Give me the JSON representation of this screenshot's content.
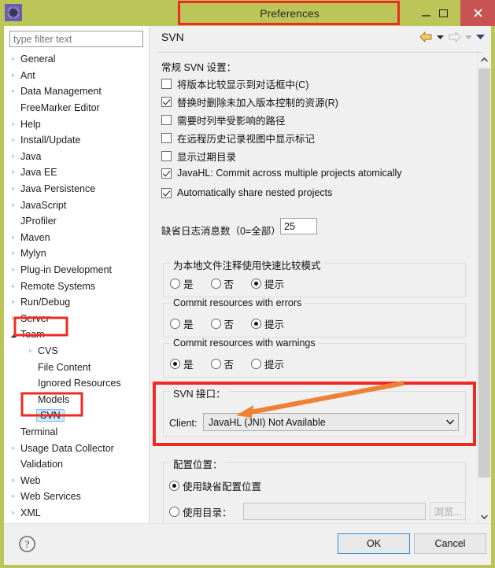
{
  "window": {
    "title": "Preferences",
    "app_icon": "gear-icon",
    "minimize_label": "–",
    "maximize_label": "□",
    "close_label": "✕",
    "titlebar_color": "#bcc557",
    "close_button_color": "#c75452",
    "highlight_color": "#ee2b22",
    "arrow_color": "#ed8134"
  },
  "sidebar": {
    "filter": {
      "value": "",
      "placeholder": "type filter text"
    },
    "items": [
      {
        "label": "General",
        "indent": 0,
        "arrow": "collapsed",
        "selected": false,
        "highlighted": false
      },
      {
        "label": "Ant",
        "indent": 0,
        "arrow": "collapsed",
        "selected": false,
        "highlighted": false
      },
      {
        "label": "Data Management",
        "indent": 0,
        "arrow": "collapsed",
        "selected": false,
        "highlighted": false
      },
      {
        "label": "FreeMarker Editor",
        "indent": 0,
        "arrow": "none",
        "selected": false,
        "highlighted": false
      },
      {
        "label": "Help",
        "indent": 0,
        "arrow": "collapsed",
        "selected": false,
        "highlighted": false
      },
      {
        "label": "Install/Update",
        "indent": 0,
        "arrow": "collapsed",
        "selected": false,
        "highlighted": false
      },
      {
        "label": "Java",
        "indent": 0,
        "arrow": "collapsed",
        "selected": false,
        "highlighted": false
      },
      {
        "label": "Java EE",
        "indent": 0,
        "arrow": "collapsed",
        "selected": false,
        "highlighted": false
      },
      {
        "label": "Java Persistence",
        "indent": 0,
        "arrow": "collapsed",
        "selected": false,
        "highlighted": false
      },
      {
        "label": "JavaScript",
        "indent": 0,
        "arrow": "collapsed",
        "selected": false,
        "highlighted": false
      },
      {
        "label": "JProfiler",
        "indent": 0,
        "arrow": "none",
        "selected": false,
        "highlighted": false
      },
      {
        "label": "Maven",
        "indent": 0,
        "arrow": "collapsed",
        "selected": false,
        "highlighted": false
      },
      {
        "label": "Mylyn",
        "indent": 0,
        "arrow": "collapsed",
        "selected": false,
        "highlighted": false
      },
      {
        "label": "Plug-in Development",
        "indent": 0,
        "arrow": "collapsed",
        "selected": false,
        "highlighted": false
      },
      {
        "label": "Remote Systems",
        "indent": 0,
        "arrow": "collapsed",
        "selected": false,
        "highlighted": false
      },
      {
        "label": "Run/Debug",
        "indent": 0,
        "arrow": "collapsed",
        "selected": false,
        "highlighted": false
      },
      {
        "label": "Server",
        "indent": 0,
        "arrow": "collapsed",
        "selected": false,
        "highlighted": false
      },
      {
        "label": "Team",
        "indent": 0,
        "arrow": "expanded",
        "selected": false,
        "highlighted": true
      },
      {
        "label": "CVS",
        "indent": 1,
        "arrow": "collapsed",
        "selected": false,
        "highlighted": false
      },
      {
        "label": "File Content",
        "indent": 1,
        "arrow": "none",
        "selected": false,
        "highlighted": false
      },
      {
        "label": "Ignored Resources",
        "indent": 1,
        "arrow": "none",
        "selected": false,
        "highlighted": false
      },
      {
        "label": "Models",
        "indent": 1,
        "arrow": "none",
        "selected": false,
        "highlighted": false
      },
      {
        "label": "SVN",
        "indent": 1,
        "arrow": "collapsed",
        "selected": true,
        "highlighted": true
      },
      {
        "label": "Terminal",
        "indent": 0,
        "arrow": "none",
        "selected": false,
        "highlighted": false
      },
      {
        "label": "Usage Data Collector",
        "indent": 0,
        "arrow": "collapsed",
        "selected": false,
        "highlighted": false
      },
      {
        "label": "Validation",
        "indent": 0,
        "arrow": "none",
        "selected": false,
        "highlighted": false
      },
      {
        "label": "Web",
        "indent": 0,
        "arrow": "collapsed",
        "selected": false,
        "highlighted": false
      },
      {
        "label": "Web Services",
        "indent": 0,
        "arrow": "collapsed",
        "selected": false,
        "highlighted": false
      },
      {
        "label": "XML",
        "indent": 0,
        "arrow": "collapsed",
        "selected": false,
        "highlighted": false
      }
    ]
  },
  "pane": {
    "title": "SVN",
    "nav": {
      "back_icon": "back-arrow-icon",
      "back_menu_icon": "chevron-down-icon",
      "forward_icon": "forward-arrow-icon",
      "forward_menu_icon": "chevron-down-icon",
      "view_menu_icon": "chevron-down-icon"
    },
    "general_section_label": "常规 SVN 设置：",
    "checkboxes": [
      {
        "label": "将版本比较显示到对话框中(C)",
        "checked": false
      },
      {
        "label": "替换时删除未加入版本控制的资源(R)",
        "checked": true
      },
      {
        "label": "需要时列举受影响的路径",
        "checked": false
      },
      {
        "label": "在远程历史记录视图中显示标记",
        "checked": false
      },
      {
        "label": "显示过期目录",
        "checked": false
      },
      {
        "label": "JavaHL: Commit across multiple projects atomically",
        "checked": true
      },
      {
        "label": "Automatically share nested projects",
        "checked": true
      }
    ],
    "log_messages": {
      "label": "缺省日志消息数（0=全部）",
      "value": "25"
    },
    "radio_groups": [
      {
        "title": "为本地文件注释使用快速比较模式",
        "options": [
          {
            "label": "是",
            "selected": false
          },
          {
            "label": "否",
            "selected": false
          },
          {
            "label": "提示",
            "selected": true
          }
        ]
      },
      {
        "title": "Commit resources with errors",
        "options": [
          {
            "label": "是",
            "selected": false
          },
          {
            "label": "否",
            "selected": false
          },
          {
            "label": "提示",
            "selected": true
          }
        ]
      },
      {
        "title": "Commit resources with warnings",
        "options": [
          {
            "label": "是",
            "selected": true
          },
          {
            "label": "否",
            "selected": false
          },
          {
            "label": "提示",
            "selected": false
          }
        ]
      }
    ],
    "svn_interface": {
      "group_title": "SVN 接口：",
      "client_label": "Client:",
      "client_value": "JavaHL (JNI) Not Available",
      "dropdown_icon": "chevron-down-icon",
      "highlighted": true
    },
    "config_location": {
      "group_title": "配置位置：",
      "default_option": {
        "label": "使用缺省配置位置",
        "selected": true
      },
      "directory_option": {
        "label": "使用目录：",
        "selected": false
      },
      "directory_value": "",
      "browse_label": "浏览..."
    },
    "scrollbar": {
      "up_icon": "chevron-up-icon",
      "down_icon": "chevron-down-icon"
    }
  },
  "footer": {
    "help_icon": "help-question-icon",
    "ok_label": "OK",
    "cancel_label": "Cancel"
  }
}
